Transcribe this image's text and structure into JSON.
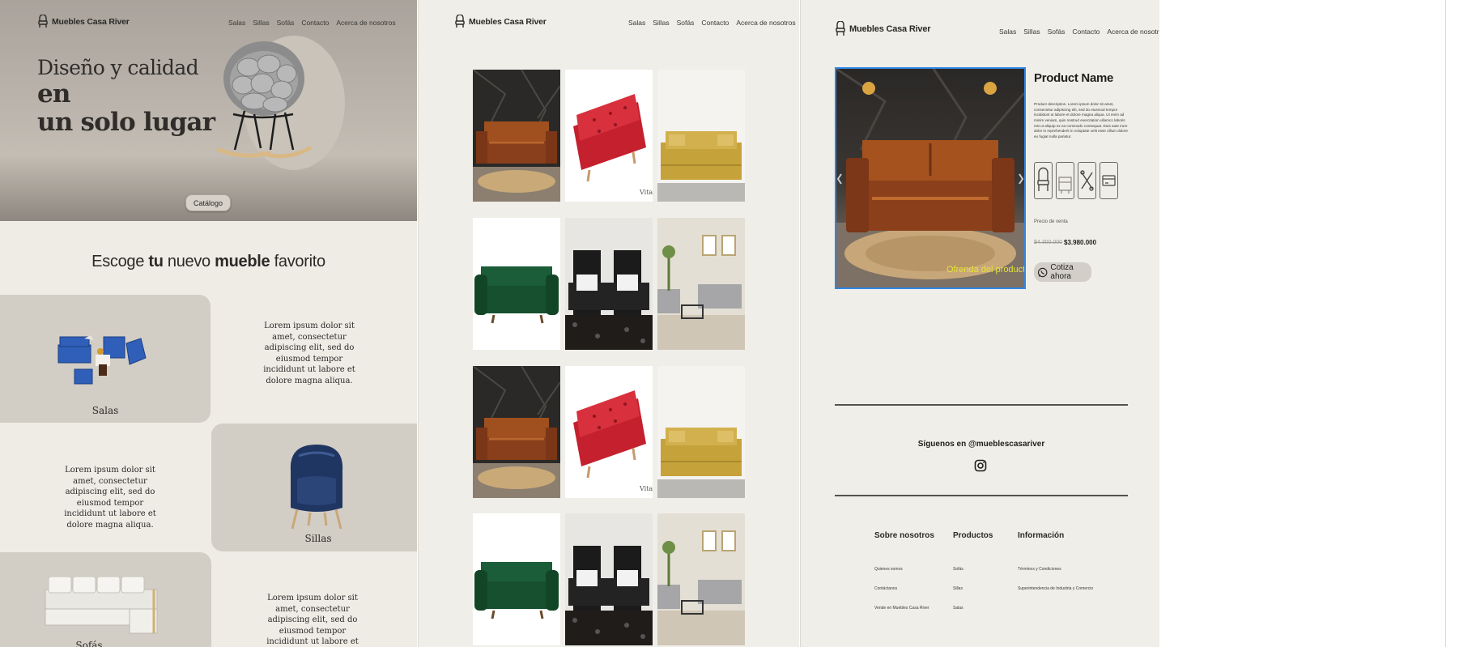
{
  "brand": "Muebles Casa River",
  "nav": [
    "Salas",
    "Sillas",
    "Sofás",
    "Contacto",
    "Acerca de nosotros"
  ],
  "home": {
    "hero_line1": "Diseño y calidad ",
    "hero_line1_bold": "en",
    "hero_line2": "un solo lugar",
    "catalog_button": "Catálogo",
    "section_pre": "Escoge ",
    "section_b1": "tu",
    "section_mid": " nuevo ",
    "section_b2": "mueble",
    "section_post": " favorito",
    "categories": [
      {
        "label": "Salas",
        "text": "Lorem ipsum dolor sit amet, consectetur adipiscing elit, sed do eiusmod tempor incididunt ut labore et dolore magna aliqua."
      },
      {
        "label": "Sillas",
        "text": "Lorem ipsum dolor sit amet, consectetur adipiscing elit, sed do eiusmod tempor incididunt ut labore et dolore magna aliqua."
      },
      {
        "label": "Sofás",
        "text": "Lorem ipsum dolor sit amet, consectetur adipiscing elit, sed do eiusmod tempor incididunt ut labore et dolore magna aliqua."
      }
    ]
  },
  "catalog": {
    "tiles": [
      "brown-leather-sofa",
      "red-tufted-sofa",
      "mustard-sofa",
      "green-sofa",
      "black-leather-recliner",
      "grey-living-room-set",
      "brown-leather-sofa",
      "red-tufted-sofa",
      "mustard-sofa",
      "green-sofa",
      "black-leather-recliner",
      "grey-living-room-set"
    ],
    "watermark": "Vital"
  },
  "product": {
    "name": "Product Name",
    "description": "Product description. Lorem ipsum dolor sit amet, consectetur adipiscing elit, sed do eiusmod tempor incididunt ut labore et dolore magna aliqua. Ut enim ad minim veniam, quis nostrud exercitation ullamco laboris nisi ut aliquip ex ea commodo consequat. Duis aute irure dolor in reprehenderit in voluptate velit esse cillum dolore eu fugiat nulla pariatur.",
    "image_caption": "Ofrenda del producto",
    "features": [
      "chair-icon",
      "sofa-icon",
      "tools-icon",
      "card-icon"
    ],
    "price_label": "Precio de venta",
    "price_old": "$4.300.000",
    "price_new": "$3.980.000",
    "quote_button": "Cotiza ahora",
    "follow": "Síguenos en @mueblescasariver",
    "footer": {
      "cols": [
        {
          "title": "Sobre nosotros",
          "links": [
            "Quienes somos",
            "Contáctanos",
            "Vende en Muebles Casa River"
          ]
        },
        {
          "title": "Productos",
          "links": [
            "Sofás",
            "Sillas",
            "Salas"
          ]
        },
        {
          "title": "Información",
          "links": [
            "Términos y Condiciones",
            "Superintendencia de Industria y Comercio"
          ]
        }
      ]
    }
  },
  "colors": {
    "hero_bg": "#b5afa7",
    "page_bg": "#efece6",
    "card_bg": "#d2cdc5",
    "accent_selection": "#2f86e6",
    "caption": "#e5e23c"
  }
}
